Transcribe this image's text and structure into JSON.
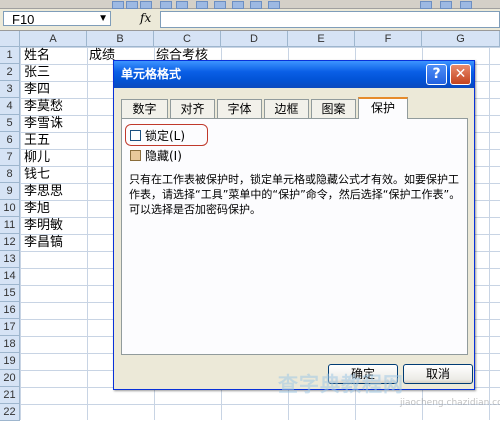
{
  "formula_bar": {
    "name_box": "F10",
    "fx_symbol": "fx"
  },
  "columns": [
    "A",
    "B",
    "C",
    "D",
    "E",
    "F",
    "G"
  ],
  "rows": [
    "1",
    "2",
    "3",
    "4",
    "5",
    "6",
    "7",
    "8",
    "9",
    "10",
    "11",
    "12",
    "13",
    "14",
    "15",
    "16",
    "17",
    "18",
    "19",
    "20",
    "21",
    "22"
  ],
  "cells": {
    "header_a1": "姓名",
    "header_b1": "成绩",
    "header_c1": "综合考核",
    "names": [
      "张三",
      "李四",
      "李莫愁",
      "李雪诛",
      "王五",
      "柳儿",
      "钱七",
      "李思思",
      "李旭",
      "李明敏",
      "李昌镐"
    ]
  },
  "dialog": {
    "title": "单元格格式",
    "help_button": "?",
    "close_button": "✕",
    "tabs": [
      "数字",
      "对齐",
      "字体",
      "边框",
      "图案",
      "保护"
    ],
    "active_tab": "保护",
    "locked_label": "锁定(L)",
    "hidden_label": "隐藏(I)",
    "description": "只有在工作表被保护时，锁定单元格或隐藏公式才有效。如要保护工作表，请选择“工具”菜单中的“保护”命令，然后选择“保护工作表”。可以选择是否加密码保护。",
    "ok_button": "确定",
    "cancel_button": "取消"
  },
  "watermark": {
    "text": "查字典教程网",
    "url": "jiaocheng.chazidian.com"
  }
}
